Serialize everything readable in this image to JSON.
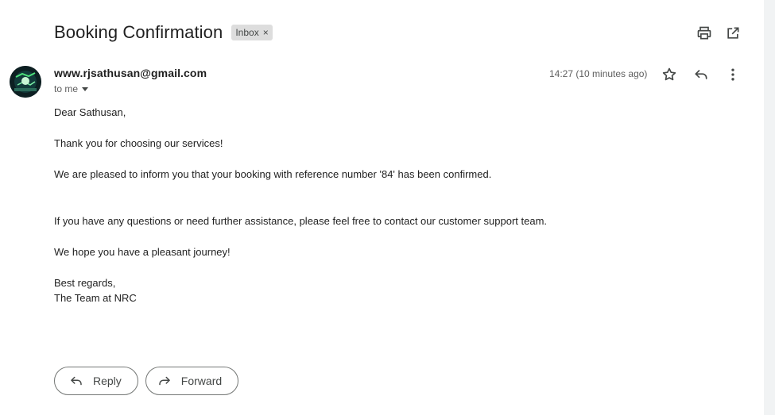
{
  "email": {
    "subject": "Booking Confirmation",
    "label": "Inbox",
    "label_remove": "×",
    "sender": "www.rjsathusan@gmail.com",
    "recipient": "to me",
    "timestamp": "14:27 (10 minutes ago)",
    "body": {
      "greeting": "Dear Sathusan,",
      "thanks": "Thank you for choosing our services!",
      "confirmation": "We are pleased to inform you that your booking with reference number '84' has been confirmed.",
      "support": "If you have any questions or need further assistance, please feel free to contact our customer support team.",
      "wish": "We hope you have a pleasant journey!",
      "closing": "Best regards,",
      "signature": "The Team at NRC"
    }
  },
  "toolbar": {
    "print_icon": "print-icon",
    "open_new_window_icon": "open-in-new-window-icon"
  },
  "message_actions": {
    "star_icon": "star-icon",
    "reply_icon": "reply-icon",
    "more_icon": "more-vert-icon"
  },
  "footer_buttons": {
    "reply_label": "Reply",
    "forward_label": "Forward"
  },
  "colors": {
    "label_chip_bg": "#dddddd",
    "icon": "#444746",
    "button_border": "#747775"
  }
}
